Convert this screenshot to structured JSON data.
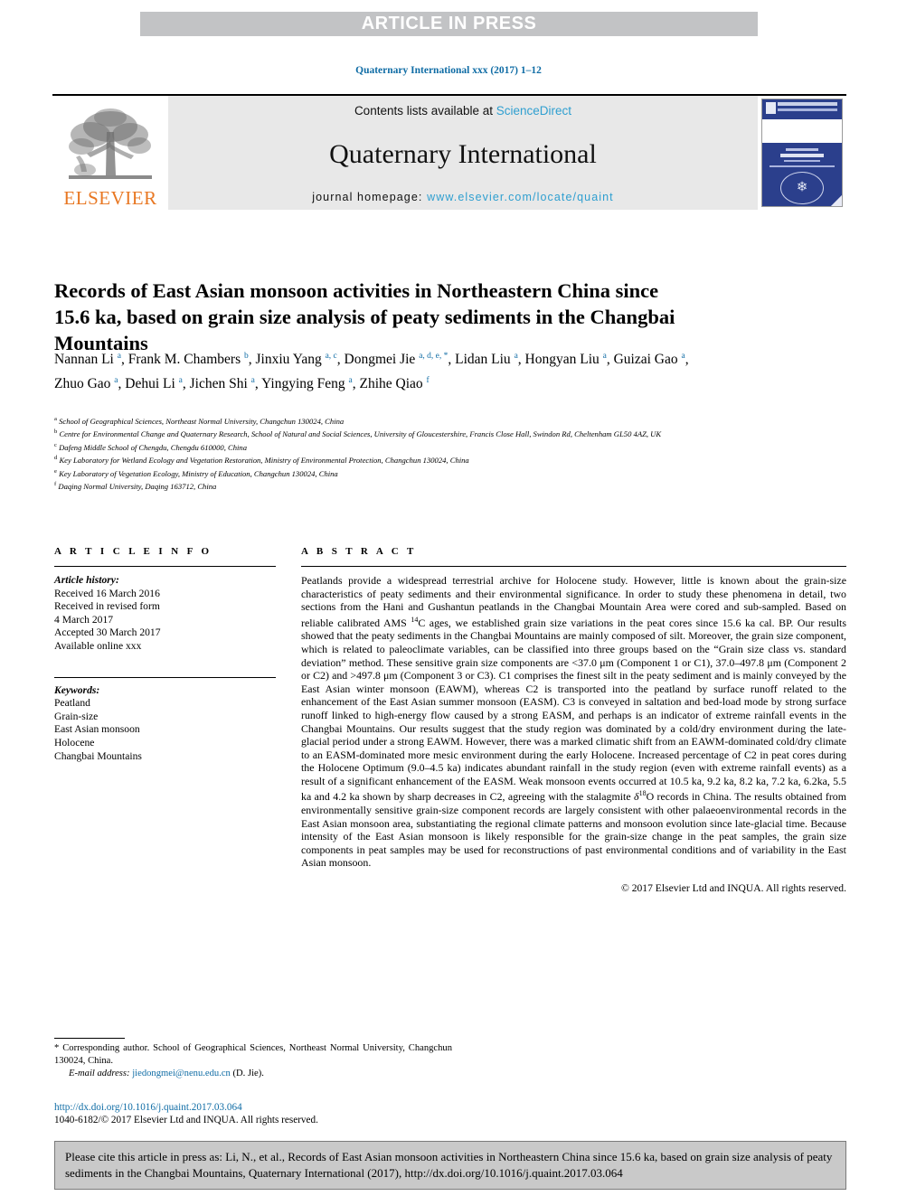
{
  "banner": {
    "text": "ARTICLE IN PRESS"
  },
  "running_head": {
    "text": "Quaternary International xxx (2017) 1–12"
  },
  "masthead": {
    "publisher_name": "ELSEVIER",
    "contents_prefix": "Contents lists available at ",
    "contents_link": "ScienceDirect",
    "journal_name": "Quaternary International",
    "homepage_label": "journal homepage: ",
    "homepage_url": "www.elsevier.com/locate/quaint",
    "cover_alt": "Quaternary International journal cover",
    "accent_color": "#2f9fd0",
    "link_color": "#0f6ca5",
    "elsevier_orange": "#e87722"
  },
  "article": {
    "title": "Records of East Asian monsoon activities in Northeastern China since 15.6 ka, based on grain size analysis of peaty sediments in the Changbai Mountains",
    "authors_html": "Nannan Li <sup>a</sup>, Frank M. Chambers <sup>b</sup>, Jinxiu Yang <sup>a, c</sup>, Dongmei Jie <sup>a, d, e, <span class=\"star\">*</span></sup>, Lidan Liu <sup>a</sup>, Hongyan Liu <sup>a</sup>, Guizai Gao <sup>a</sup>, Zhuo Gao <sup>a</sup>, Dehui Li <sup>a</sup>, Jichen Shi <sup>a</sup>, Yingying Feng <sup>a</sup>, Zhihe Qiao <sup>f</sup>",
    "affiliations": [
      {
        "marker": "a",
        "text": "School of Geographical Sciences, Northeast Normal University, Changchun 130024, China"
      },
      {
        "marker": "b",
        "text": "Centre for Environmental Change and Quaternary Research, School of Natural and Social Sciences, University of Gloucestershire, Francis Close Hall, Swindon Rd, Cheltenham GL50 4AZ, UK"
      },
      {
        "marker": "c",
        "text": "Dafeng Middle School of Chengdu, Chengdu 610000, China"
      },
      {
        "marker": "d",
        "text": "Key Laboratory for Wetland Ecology and Vegetation Restoration, Ministry of Environmental Protection, Changchun 130024, China"
      },
      {
        "marker": "e",
        "text": "Key Laboratory of Vegetation Ecology, Ministry of Education, Changchun 130024, China"
      },
      {
        "marker": "f",
        "text": "Daqing Normal University, Daqing 163712, China"
      }
    ]
  },
  "article_info": {
    "heading": "A R T I C L E   I N F O",
    "history_label": "Article history:",
    "history_lines": [
      "Received 16 March 2016",
      "Received in revised form",
      "4 March 2017",
      "Accepted 30 March 2017",
      "Available online xxx"
    ],
    "keywords_label": "Keywords:",
    "keywords": [
      "Peatland",
      "Grain-size",
      "East Asian monsoon",
      "Holocene",
      "Changbai Mountains"
    ]
  },
  "abstract": {
    "heading": "A B S T R A C T",
    "body_html": "Peatlands provide a widespread terrestrial archive for Holocene study. However, little is known about the grain-size characteristics of peaty sediments and their environmental significance. In order to study these phenomena in detail, two sections from the Hani and Gushantun peatlands in the Changbai Mountain Area were cored and sub-sampled. Based on reliable calibrated AMS <sup>14</sup>C ages, we established grain size variations in the peat cores since 15.6 ka cal. BP. Our results showed that the peaty sediments in the Changbai Mountains are mainly composed of silt. Moreover, the grain size component, which is related to paleoclimate variables, can be classified into three groups based on the “Grain size class vs. standard deviation” method. These sensitive grain size components are &lt;37.0 μm (Component 1 or C1), 37.0–497.8 μm (Component 2 or C2) and &gt;497.8 μm (Component 3 or C3). C1 comprises the finest silt in the peaty sediment and is mainly conveyed by the East Asian winter monsoon (EAWM), whereas C2 is transported into the peatland by surface runoff related to the enhancement of the East Asian summer monsoon (EASM). C3 is conveyed in saltation and bed-load mode by strong surface runoff linked to high-energy flow caused by a strong EASM, and perhaps is an indicator of extreme rainfall events in the Changbai Mountains. Our results suggest that the study region was dominated by a cold/dry environment during the late-glacial period under a strong EAWM. However, there was a marked climatic shift from an EAWM-dominated cold/dry climate to an EASM-dominated more mesic environment during the early Holocene. Increased percentage of C2 in peat cores during the Holocene Optimum (9.0–4.5 ka) indicates abundant rainfall in the study region (even with extreme rainfall events) as a result of a significant enhancement of the EASM. Weak monsoon events occurred at 10.5 ka, 9.2 ka, 8.2 ka, 7.2 ka, 6.2ka, 5.5 ka and 4.2 ka shown by sharp decreases in C2, agreeing with the stalagmite <i>δ</i><sup>18</sup>O records in China. The results obtained from environmentally sensitive grain-size component records are largely consistent with other palaeoenvironmental records in the East Asian monsoon area, substantiating the regional climate patterns and monsoon evolution since late-glacial time. Because intensity of the East Asian monsoon is likely responsible for the grain-size change in the peat samples, the grain size components in peat samples may be used for reconstructions of past environmental conditions and of variability in the East Asian monsoon.",
    "copyright": "© 2017 Elsevier Ltd and INQUA. All rights reserved."
  },
  "footnotes": {
    "corresponding_marker": "*",
    "corresponding_text": "Corresponding author. School of Geographical Sciences, Northeast Normal University, Changchun 130024, China.",
    "email_label": "E-mail address:",
    "email_address": "jiedongmei@nenu.edu.cn",
    "email_attribution": "(D. Jie)."
  },
  "doi_block": {
    "doi_url": "http://dx.doi.org/10.1016/j.quaint.2017.03.064",
    "issn_line": "1040-6182/© 2017 Elsevier Ltd and INQUA. All rights reserved."
  },
  "citation_box": {
    "text": "Please cite this article in press as: Li, N., et al., Records of East Asian monsoon activities in Northeastern China since 15.6 ka, based on grain size analysis of peaty sediments in the Changbai Mountains, Quaternary International (2017), http://dx.doi.org/10.1016/j.quaint.2017.03.064"
  }
}
